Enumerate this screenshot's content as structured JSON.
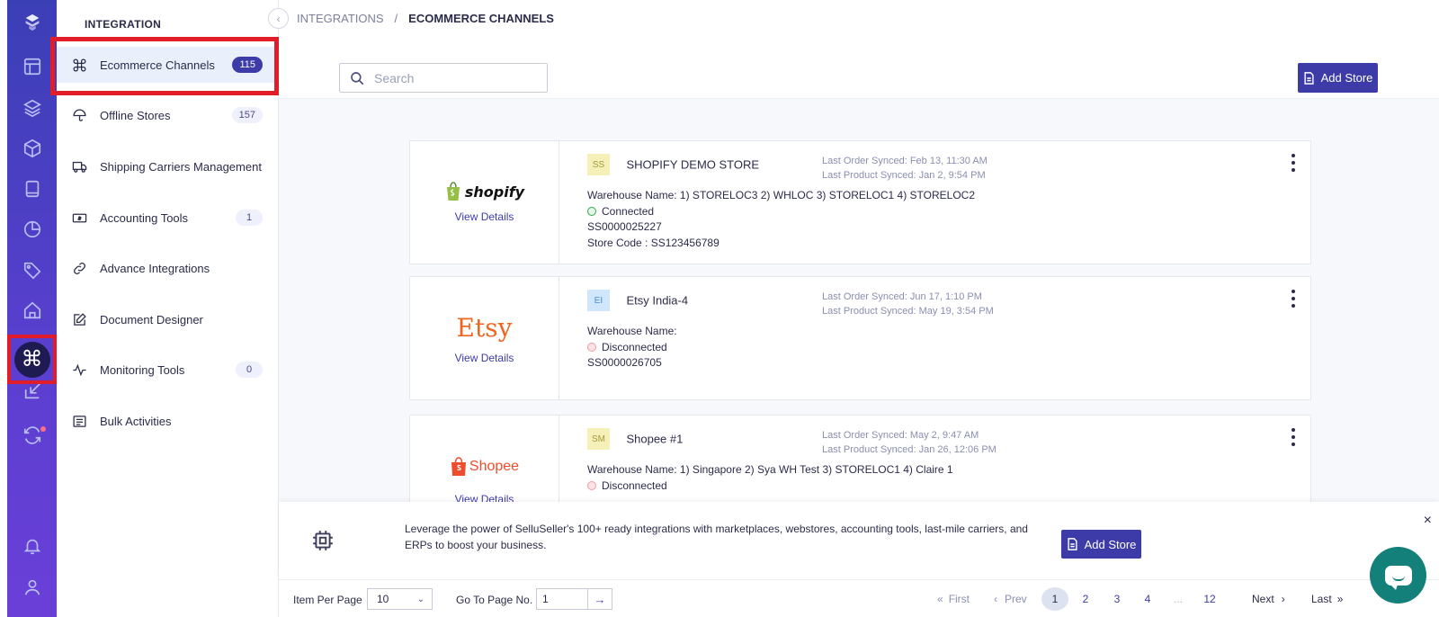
{
  "sidebar": {
    "title": "INTEGRATION",
    "items": [
      {
        "label": "Ecommerce Channels",
        "badge": "115"
      },
      {
        "label": "Offline Stores",
        "badge": "157"
      },
      {
        "label": "Shipping Carriers Management",
        "badge": ""
      },
      {
        "label": "Accounting Tools",
        "badge": "1"
      },
      {
        "label": "Advance Integrations",
        "badge": ""
      },
      {
        "label": "Document Designer",
        "badge": ""
      },
      {
        "label": "Monitoring Tools",
        "badge": "0"
      },
      {
        "label": "Bulk Activities",
        "badge": ""
      }
    ]
  },
  "breadcrumb": {
    "parent": "INTEGRATIONS",
    "separator": "/",
    "current": "ECOMMERCE CHANNELS"
  },
  "search": {
    "placeholder": "Search"
  },
  "toolbar": {
    "add_store_label": "Add Store"
  },
  "stores": [
    {
      "logo_text": "shopify",
      "abbr": "SS",
      "name": "SHOPIFY DEMO STORE",
      "last_order": "Last Order Synced: Feb 13, 11:30 AM",
      "last_product": "Last Product Synced: Jan 2, 9:54 PM",
      "warehouse": "Warehouse Name: 1) STORELOC3 2) WHLOC 3) STORELOC1 4) STORELOC2",
      "status": "Connected",
      "store_id": "SS0000025227",
      "store_code": "Store Code : SS123456789",
      "view_details": "View Details"
    },
    {
      "logo_text": "Etsy",
      "abbr": "EI",
      "name": "Etsy India-4",
      "last_order": "Last Order Synced: Jun 17, 1:10 PM",
      "last_product": "Last Product Synced: May 19, 3:54 PM",
      "warehouse": "Warehouse Name:",
      "status": "Disconnected",
      "store_id": "SS0000026705",
      "view_details": "View Details"
    },
    {
      "logo_text": "Shopee",
      "abbr": "SM",
      "name": "Shopee #1",
      "last_order": "Last Order Synced: May 2, 9:47 AM",
      "last_product": "Last Product Synced: Jan 26, 12:06 PM",
      "warehouse": "Warehouse Name: 1) Singapore 2) Sya WH Test 3) STORELOC1 4) Claire 1",
      "status": "Disconnected",
      "view_details": "View Details"
    }
  ],
  "banner": {
    "text": "Leverage the power of SelluSeller's 100+ ready integrations with marketplaces, webstores, accounting tools, last-mile carriers, and ERPs to boost your business.",
    "button_label": "Add Store",
    "close": "×"
  },
  "pagination": {
    "per_page_label": "Item Per Page",
    "per_page_value": "10",
    "goto_label": "Go To Page No.",
    "goto_value": "1",
    "first": "First",
    "prev": "Prev",
    "pages": [
      "1",
      "2",
      "3",
      "4",
      "...",
      "12"
    ],
    "next": "Next",
    "last": "Last"
  },
  "colors": {
    "primary": "#3d3ba7",
    "rail": "#4a3fc4",
    "connected": "#2aa745",
    "disconnected": "#f09aa3",
    "highlight": "#e11d2a"
  },
  "icons": [
    "logo-icon",
    "layout-icon",
    "layers-icon",
    "box-icon",
    "book-icon",
    "pie-chart-icon",
    "tag-icon",
    "home-icon",
    "command-icon",
    "import-icon",
    "sync-icon",
    "bell-icon",
    "user-icon"
  ]
}
